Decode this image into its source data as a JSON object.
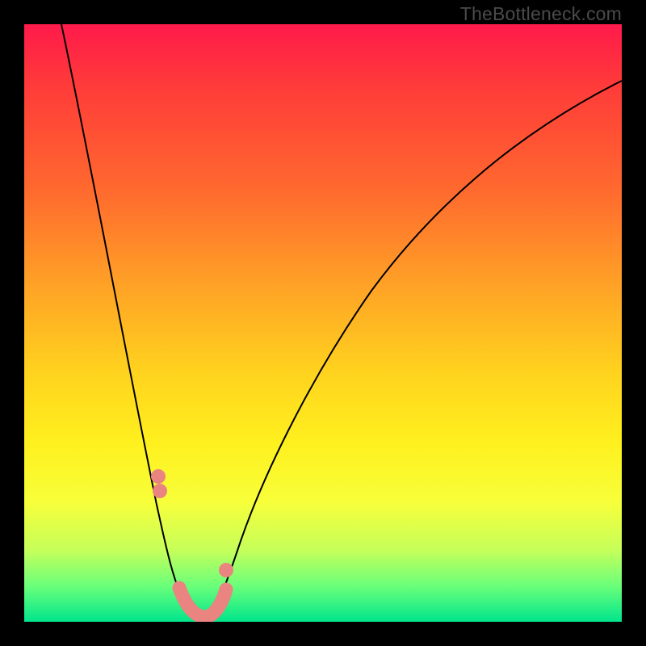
{
  "attribution": "TheBottleneck.com",
  "chart_data": {
    "type": "line",
    "title": "",
    "xlabel": "",
    "ylabel": "",
    "xlim": [
      0,
      100
    ],
    "ylim": [
      0,
      100
    ],
    "series": [
      {
        "name": "bottleneck-curve",
        "x": [
          6,
          8,
          10,
          12,
          14,
          16,
          18,
          20,
          22,
          24,
          25,
          26,
          27,
          28,
          29,
          30,
          31,
          33,
          36,
          40,
          45,
          50,
          55,
          60,
          65,
          70,
          75,
          80,
          85,
          90,
          95,
          100
        ],
        "y": [
          100,
          92,
          84,
          76,
          68,
          60,
          52,
          44,
          36,
          24,
          16,
          9,
          4,
          1,
          0,
          0.5,
          2,
          6,
          12,
          20,
          30,
          39,
          47,
          54,
          60,
          65,
          69.5,
          73.5,
          77,
          80,
          82.5,
          85
        ]
      }
    ],
    "markers": {
      "name": "highlighted-points",
      "x": [
        22.3,
        22.7,
        25.8,
        27.0,
        28.0,
        29.0,
        30.0,
        31.0,
        32.0,
        33.0,
        33.5
      ],
      "y": [
        25,
        22,
        4.5,
        1.5,
        0.5,
        0.2,
        0.4,
        1.0,
        2.5,
        5.5,
        8.5
      ]
    },
    "background_gradient": {
      "top": "#ff1a4b",
      "bottom": "#00e58c"
    }
  }
}
